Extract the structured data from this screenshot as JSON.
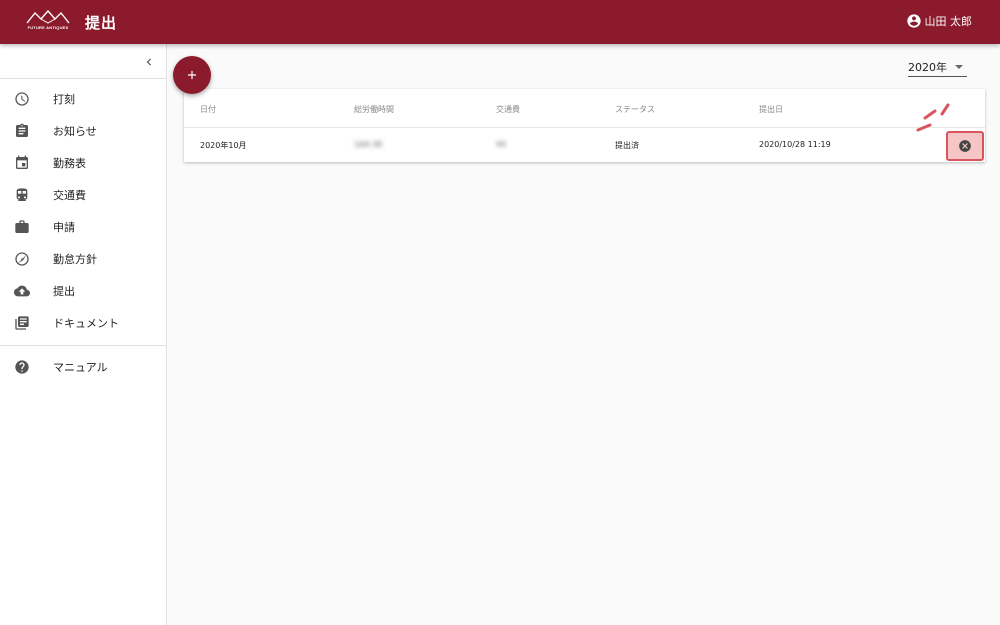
{
  "header": {
    "logo_text": "FUTURE ANTIQUES",
    "title": "提出",
    "user_name": "山田 太郎",
    "color": "#8b1a2c"
  },
  "sidebar": {
    "collapse_icon": "chevron-left-icon",
    "items": [
      {
        "label": "打刻",
        "icon": "clock-icon"
      },
      {
        "label": "お知らせ",
        "icon": "clipboard-icon"
      },
      {
        "label": "勤務表",
        "icon": "calendar-icon"
      },
      {
        "label": "交通費",
        "icon": "train-icon"
      },
      {
        "label": "申請",
        "icon": "briefcase-icon"
      },
      {
        "label": "勤怠方針",
        "icon": "compass-icon"
      },
      {
        "label": "提出",
        "icon": "cloud-upload-icon"
      },
      {
        "label": "ドキュメント",
        "icon": "library-books-icon"
      }
    ],
    "secondary_items": [
      {
        "label": "マニュアル",
        "icon": "help-icon"
      }
    ]
  },
  "toolbar": {
    "add_icon": "plus-icon",
    "year_value": "2020年"
  },
  "table": {
    "columns": [
      "日付",
      "総労働時間",
      "交通費",
      "ステータス",
      "提出日"
    ],
    "rows": [
      {
        "date": "2020年10月",
        "total_hours": "164:38",
        "transport": "¥0",
        "status": "提出済",
        "submitted": "2020/10/28 11:19"
      }
    ],
    "delete_icon": "cancel-icon",
    "highlight_color": "#d9555d"
  }
}
